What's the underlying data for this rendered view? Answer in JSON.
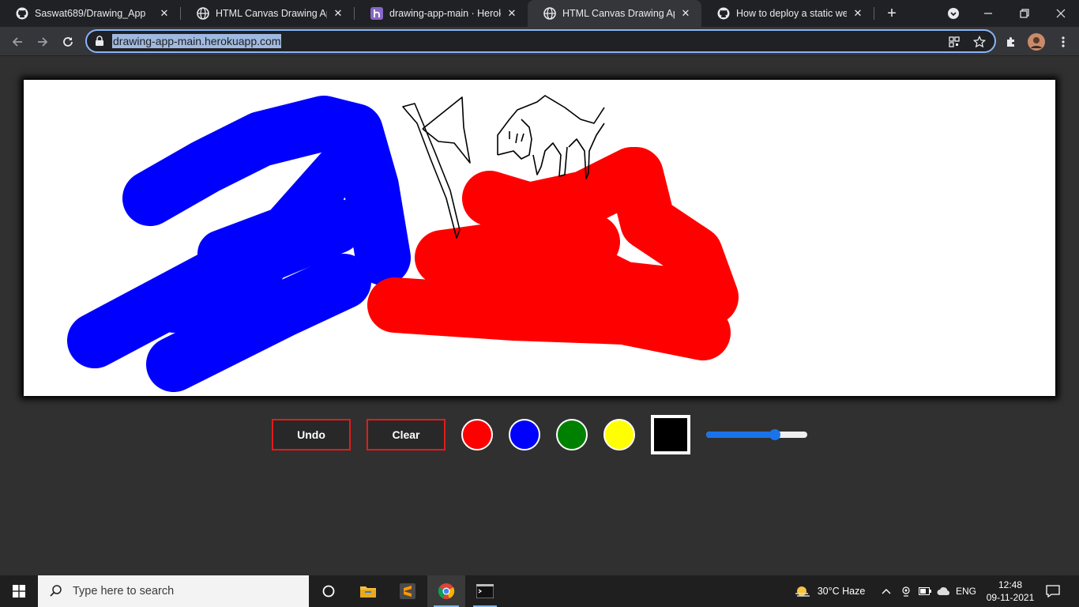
{
  "browser": {
    "tabs": [
      {
        "title": "Saswat689/Drawing_App",
        "icon": "github-icon",
        "active": false
      },
      {
        "title": "HTML Canvas Drawing App",
        "icon": "globe-icon",
        "active": false
      },
      {
        "title": "drawing-app-main · Heroku-g",
        "icon": "heroku-icon",
        "active": false
      },
      {
        "title": "HTML Canvas Drawing App",
        "icon": "globe-icon",
        "active": true
      },
      {
        "title": "How to deploy a static websit",
        "icon": "github-icon",
        "active": false
      }
    ],
    "address": "drawing-app-main.herokuapp.com"
  },
  "app": {
    "undo_label": "Undo",
    "clear_label": "Clear",
    "swatches": [
      {
        "name": "red",
        "color": "#ff0000"
      },
      {
        "name": "blue",
        "color": "#0000ff"
      },
      {
        "name": "green",
        "color": "#008000"
      },
      {
        "name": "yellow",
        "color": "#ffff00"
      }
    ],
    "picker_color": "#000000",
    "brush_size_fraction": 0.68,
    "accent": "#e31b1b"
  },
  "taskbar": {
    "search_placeholder": "Type here to search",
    "weather": "30°C  Haze",
    "language": "ENG",
    "time": "12:48",
    "date": "09-11-2021"
  }
}
